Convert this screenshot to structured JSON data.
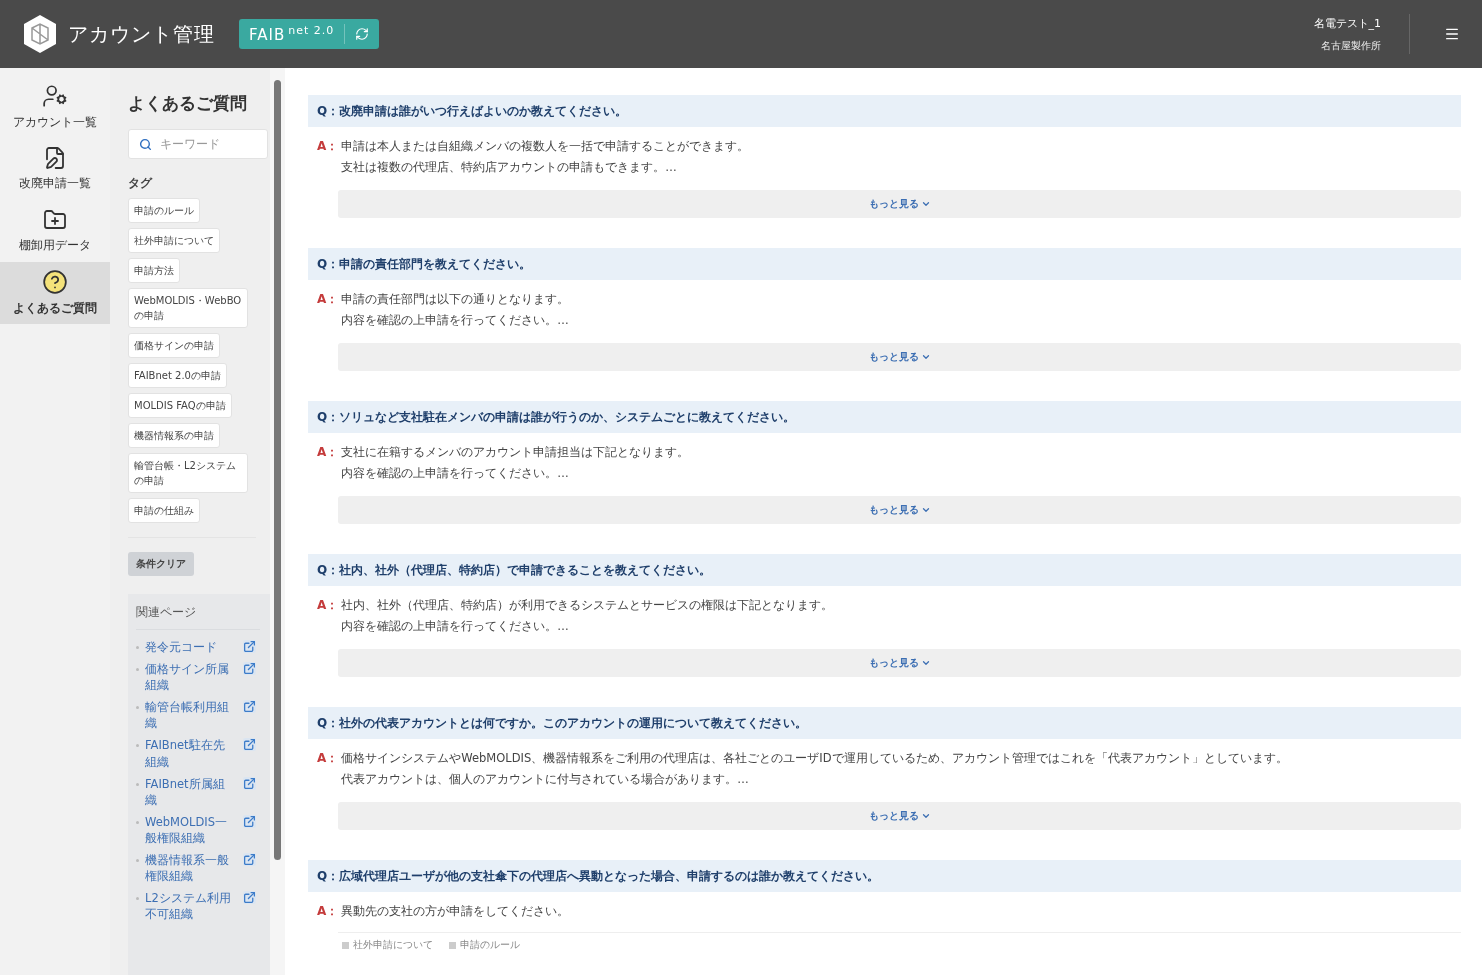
{
  "header": {
    "title": "アカウント管理",
    "brand": {
      "main": "FAIB",
      "sub": "net 2.0"
    },
    "user_name": "名電テスト_1",
    "org": "名古屋製作所"
  },
  "nav": [
    {
      "label": "アカウント一覧",
      "selected": false,
      "kind": "accounts"
    },
    {
      "label": "改廃申請一覧",
      "selected": false,
      "kind": "requests"
    },
    {
      "label": "棚卸用データ",
      "selected": false,
      "kind": "inventory"
    },
    {
      "label": "よくあるご質問",
      "selected": true,
      "kind": "faq"
    }
  ],
  "sidebar": {
    "title": "よくあるご質問",
    "search": {
      "placeholder": "キーワード"
    },
    "tags_heading": "タグ",
    "tags": [
      "申請のルール",
      "社外申請について",
      "申請方法",
      "WebMOLDIS・WebBOの申請",
      "価格サインの申請",
      "FAIBnet 2.0の申請",
      "MOLDIS FAQの申請",
      "機器情報系の申請",
      "輸管台帳・L2システムの申請",
      "申請の仕組み"
    ],
    "clear_button": "条件クリア",
    "related": {
      "heading": "関連ページ",
      "links": [
        "発令元コード",
        "価格サイン所属組織",
        "輸管台帳利用組織",
        "FAIBnet駐在先組織",
        "FAIBnet所属組織",
        "WebMOLDIS一般権限組織",
        "機器情報系一般権限組織",
        "L2システム利用不可組織"
      ]
    }
  },
  "faqs": [
    {
      "question": "Q：改廃申請は誰がいつ行えばよいのか教えてください。",
      "marker": "A：",
      "answer": [
        "申請は本人または自組織メンバの複数人を一括で申請することができます。",
        "支社は複数の代理店、特約店アカウントの申請もできます。…"
      ],
      "more": "もっと見る"
    },
    {
      "question": "Q：申請の責任部門を教えてください。",
      "marker": "A：",
      "answer": [
        "申請の責任部門は以下の通りとなります。",
        "内容を確認の上申請を行ってください。…"
      ],
      "more": "もっと見る"
    },
    {
      "question": "Q：ソリュなど支社駐在メンバの申請は誰が行うのか、システムごとに教えてください。",
      "marker": "A：",
      "answer": [
        "支社に在籍するメンバのアカウント申請担当は下記となります。",
        "内容を確認の上申請を行ってください。…"
      ],
      "more": "もっと見る"
    },
    {
      "question": "Q：社内、社外（代理店、特約店）で申請できることを教えてください。",
      "marker": "A：",
      "answer": [
        "社内、社外（代理店、特約店）が利用できるシステムとサービスの権限は下記となります。",
        "内容を確認の上申請を行ってください。…"
      ],
      "more": "もっと見る"
    },
    {
      "question": "Q：社外の代表アカウントとは何ですか。このアカウントの運用について教えてください。",
      "marker": "A：",
      "answer": [
        "価格サインシステムやWebMOLDIS、機器情報系をご利用の代理店は、各社ごとのユーザIDで運用しているため、アカウント管理ではこれを「代表アカウント」としています。",
        "代表アカウントは、個人のアカウントに付与されている場合があります。…"
      ],
      "more": "もっと見る"
    },
    {
      "question": "Q：広域代理店ユーザが他の支社傘下の代理店へ異動となった場合、申請するのは誰か教えてください。",
      "marker": "A：",
      "answer": [
        "異動先の支社の方が申請をしてください。"
      ],
      "tags": [
        "社外申請について",
        "申請のルール"
      ]
    }
  ]
}
